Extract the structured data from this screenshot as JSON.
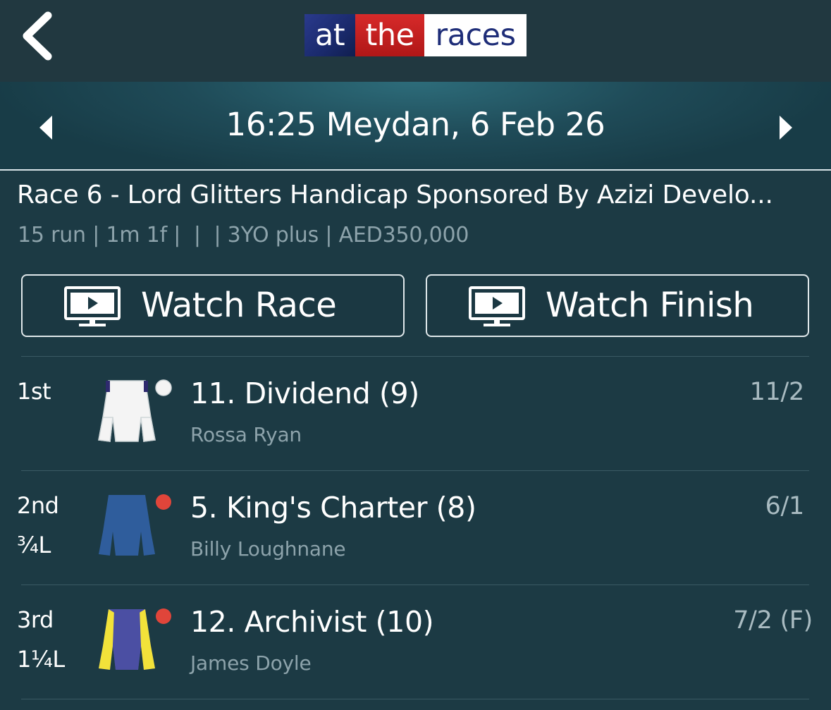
{
  "header": {
    "back_icon": "chevron-left-icon",
    "logo": {
      "part1": "at",
      "part2": "the",
      "part3": "races"
    }
  },
  "race_nav": {
    "title": "16:25 Meydan, 6 Feb 26",
    "prev_icon": "triangle-left-icon",
    "next_icon": "triangle-right-icon"
  },
  "race": {
    "name": "Race 6 - Lord Glitters Handicap Sponsored By Azizi Develo...",
    "meta": "15 run | 1m 1f |  |  | 3YO plus | AED350,000"
  },
  "buttons": {
    "watch_race": "Watch Race",
    "watch_finish": "Watch Finish",
    "icon": "tv-play-icon"
  },
  "results": [
    {
      "position": "1st",
      "distance": "",
      "horse": "11. Dividend (9)",
      "jockey": "Rossa Ryan",
      "odds": "11/2",
      "silk": {
        "body": "#f4f4f4",
        "sleeves": "#f4f4f4",
        "trim": "#2e2a6e",
        "cap": "#f4f4f4"
      }
    },
    {
      "position": "2nd",
      "distance": "¾L",
      "horse": "5. King's Charter (8)",
      "jockey": "Billy Loughnane",
      "odds": "6/1",
      "silk": {
        "body": "#2f5d9c",
        "sleeves": "#2f5d9c",
        "trim": "#2f5d9c",
        "cap": "#e0453a"
      }
    },
    {
      "position": "3rd",
      "distance": "1¼L",
      "horse": "12. Archivist (10)",
      "jockey": "James Doyle",
      "odds": "7/2 (F)",
      "silk": {
        "body": "#4b4fa3",
        "sleeves": "#f2e23a",
        "trim": "#4b4fa3",
        "cap": "#e0453a"
      }
    }
  ],
  "colors": {
    "background": "#1c3a44",
    "header": "#213840",
    "secondary_text": "#8da3ab"
  }
}
